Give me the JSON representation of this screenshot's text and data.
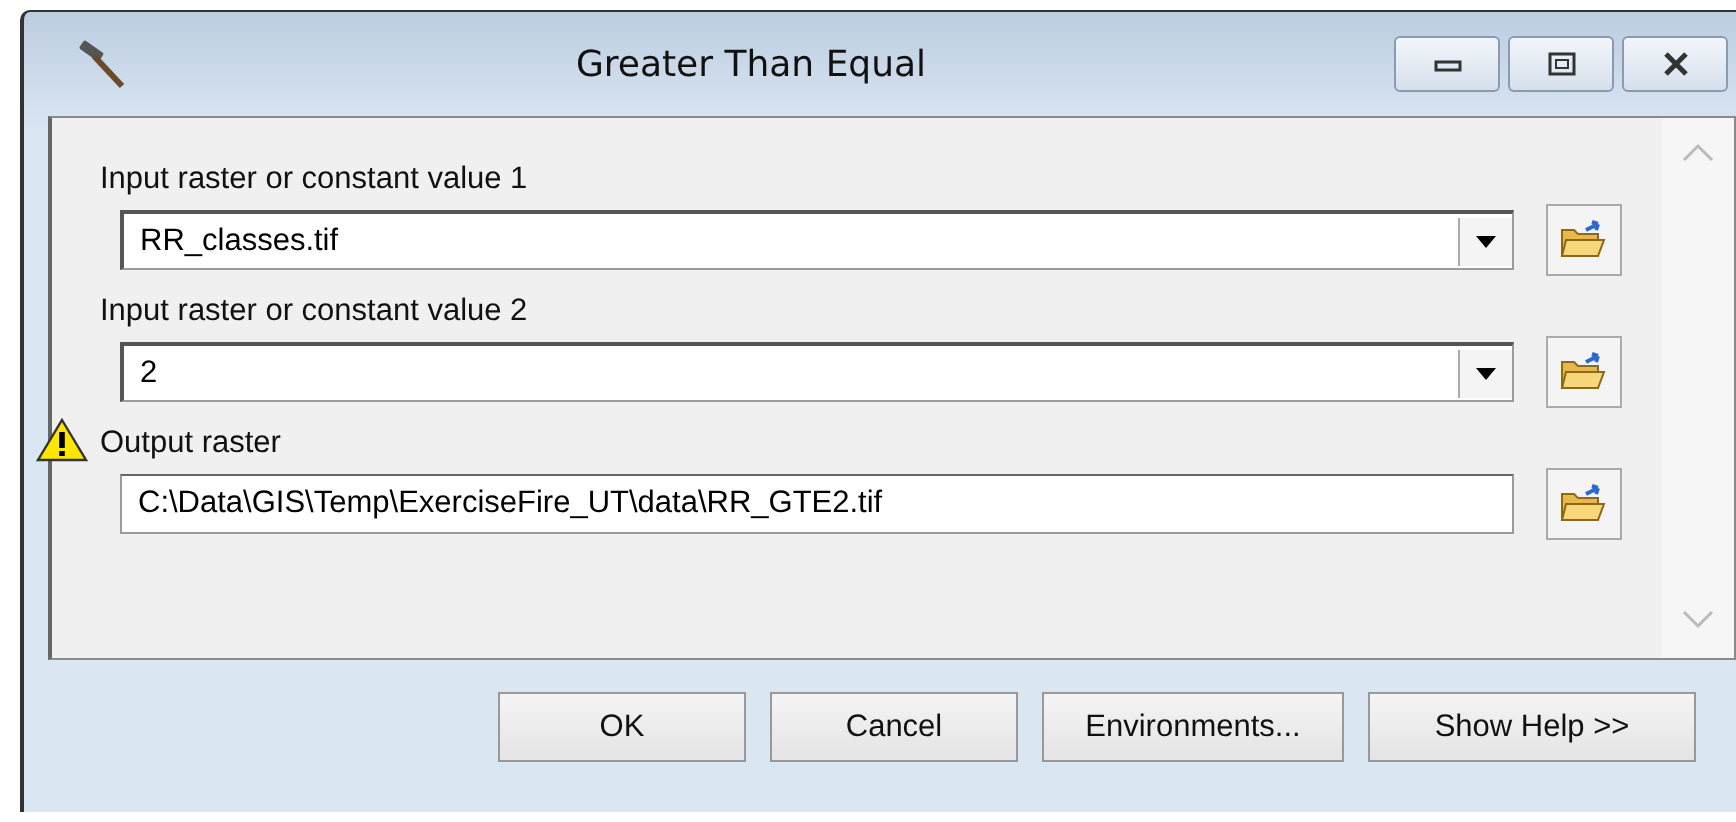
{
  "window": {
    "title": "Greater Than Equal"
  },
  "parameters": [
    {
      "kind": "combo",
      "label": "Input raster or constant value 1",
      "value": "RR_classes.tif",
      "warning": false
    },
    {
      "kind": "combo",
      "label": "Input raster or constant value 2",
      "value": "2",
      "warning": false
    },
    {
      "kind": "text",
      "label": "Output raster",
      "value": "C:\\Data\\GIS\\Temp\\ExerciseFire_UT\\data\\RR_GTE2.tif",
      "warning": true
    }
  ],
  "buttons": [
    "OK",
    "Cancel",
    "Environments...",
    "Show Help >>"
  ]
}
